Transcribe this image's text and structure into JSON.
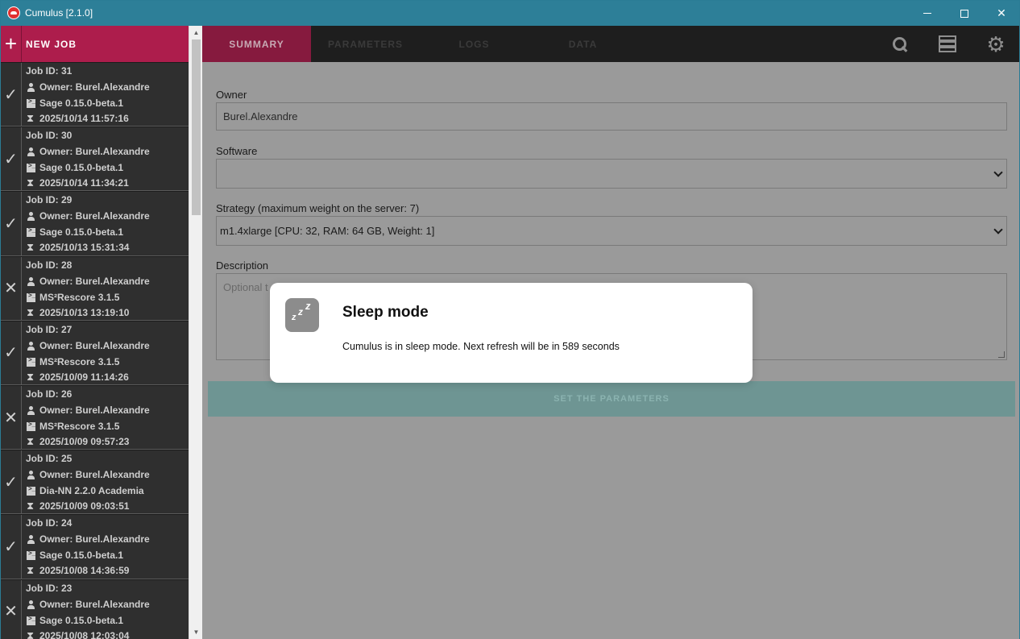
{
  "window": {
    "title": "Cumulus [2.1.0]"
  },
  "sidebar": {
    "new_job_label": "NEW JOB",
    "jobs": [
      {
        "id": "Job ID: 31",
        "owner": "Owner: Burel.Alexandre",
        "software": "Sage 0.15.0-beta.1",
        "date": "2025/10/14 11:57:16",
        "status": "✓"
      },
      {
        "id": "Job ID: 30",
        "owner": "Owner: Burel.Alexandre",
        "software": "Sage 0.15.0-beta.1",
        "date": "2025/10/14 11:34:21",
        "status": "✓"
      },
      {
        "id": "Job ID: 29",
        "owner": "Owner: Burel.Alexandre",
        "software": "Sage 0.15.0-beta.1",
        "date": "2025/10/13 15:31:34",
        "status": "✓"
      },
      {
        "id": "Job ID: 28",
        "owner": "Owner: Burel.Alexandre",
        "software": "MS²Rescore 3.1.5",
        "date": "2025/10/13 13:19:10",
        "status": "✕"
      },
      {
        "id": "Job ID: 27",
        "owner": "Owner: Burel.Alexandre",
        "software": "MS²Rescore 3.1.5",
        "date": "2025/10/09 11:14:26",
        "status": "✓"
      },
      {
        "id": "Job ID: 26",
        "owner": "Owner: Burel.Alexandre",
        "software": "MS²Rescore 3.1.5",
        "date": "2025/10/09 09:57:23",
        "status": "✕"
      },
      {
        "id": "Job ID: 25",
        "owner": "Owner: Burel.Alexandre",
        "software": "Dia-NN 2.2.0 Academia",
        "date": "2025/10/09 09:03:51",
        "status": "✓"
      },
      {
        "id": "Job ID: 24",
        "owner": "Owner: Burel.Alexandre",
        "software": "Sage 0.15.0-beta.1",
        "date": "2025/10/08 14:36:59",
        "status": "✓"
      },
      {
        "id": "Job ID: 23",
        "owner": "Owner: Burel.Alexandre",
        "software": "Sage 0.15.0-beta.1",
        "date": "2025/10/08 12:03:04",
        "status": "✕"
      }
    ]
  },
  "tabs": {
    "summary": "SUMMARY",
    "parameters": "PARAMETERS",
    "logs": "LOGS",
    "data": "DATA"
  },
  "form": {
    "owner_label": "Owner",
    "owner_value": "Burel.Alexandre",
    "software_label": "Software",
    "software_value": "",
    "strategy_label": "Strategy (maximum weight on the server: 7)",
    "strategy_value": "m1.4xlarge [CPU: 32, RAM: 64 GB, Weight: 1]",
    "description_label": "Description",
    "description_placeholder": "Optional t",
    "set_button": "SET THE PARAMETERS"
  },
  "modal": {
    "title": "Sleep mode",
    "message": "Cumulus is in sleep mode. Next refresh will be in 589 seconds"
  },
  "icons": {
    "app": "cloud-icon",
    "search": "search-icon",
    "server": "server-list-icon",
    "settings": "gear-icon",
    "sleep": "sleep-zzz-icon"
  },
  "colors": {
    "titlebar": "#2d7f98",
    "accent": "#ad1d4c",
    "set_button": "#6e9593"
  }
}
